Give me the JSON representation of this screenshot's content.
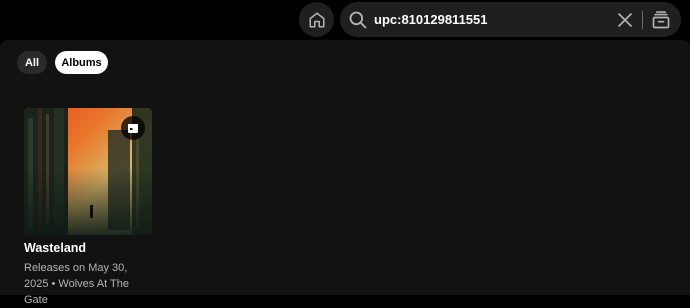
{
  "search": {
    "query": "upc:810129811551"
  },
  "filters": {
    "all_label": "All",
    "albums_label": "Albums"
  },
  "results": [
    {
      "title": "Wasteland",
      "subtitle_line1": "Releases on May 30,",
      "subtitle_line2": "2025 • Wolves At The Gate",
      "badge_icon": "calendar-icon"
    }
  ],
  "colors": {
    "background": "#000000",
    "panel": "#121212",
    "control": "#1f1f1f",
    "chip_inactive": "#2a2a2a",
    "chip_active": "#ffffff",
    "secondary_text": "#b3b3b3"
  },
  "icons": {
    "home": "home-icon",
    "search": "search-icon",
    "clear": "close-icon",
    "browse": "browse-icon"
  }
}
